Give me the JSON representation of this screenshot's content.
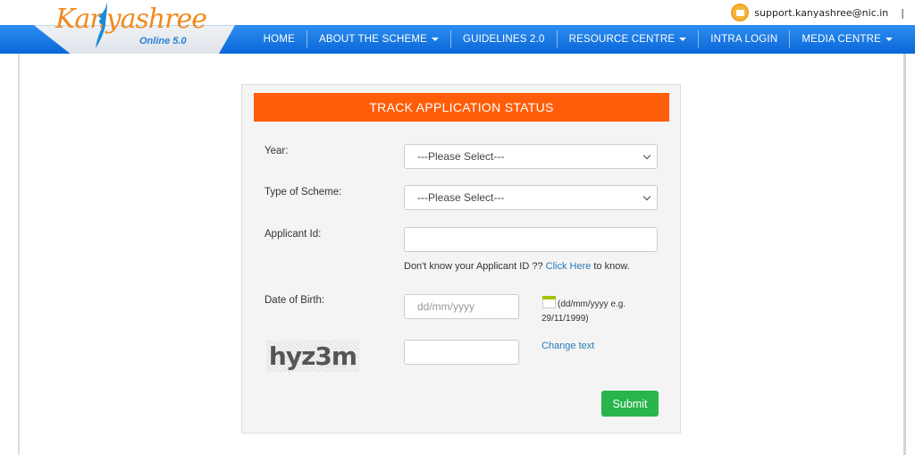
{
  "header": {
    "logo_text": "Kanyashree",
    "logo_subtitle": "Online 5.0",
    "support_email": "support.kanyashree@nic.in",
    "separator": "|"
  },
  "nav": {
    "items": [
      {
        "label": "HOME",
        "dropdown": false
      },
      {
        "label": "ABOUT THE SCHEME",
        "dropdown": true
      },
      {
        "label": "GUIDELINES 2.0",
        "dropdown": false
      },
      {
        "label": "RESOURCE CENTRE",
        "dropdown": true
      },
      {
        "label": "INTRA LOGIN",
        "dropdown": false
      },
      {
        "label": "MEDIA CENTRE",
        "dropdown": true
      }
    ]
  },
  "form": {
    "title": "TRACK APPLICATION STATUS",
    "year_label": "Year:",
    "year_value": "---Please Select---",
    "scheme_label": "Type of Scheme:",
    "scheme_value": "---Please Select---",
    "applicant_label": "Applicant Id:",
    "applicant_value": "",
    "hint_prefix": "Don't know your Applicant ID ?? ",
    "hint_link": "Click Here",
    "hint_suffix": " to know.",
    "dob_label": "Date of Birth:",
    "dob_placeholder": "dd/mm/yyyy",
    "dob_hint": "(dd/mm/yyyy e.g. 29/11/1999)",
    "captcha_text": "hyz3m",
    "captcha_value": "",
    "change_text": "Change text",
    "submit_label": "Submit"
  },
  "colors": {
    "nav_blue": "#1a7ae6",
    "header_orange": "#ff5d0a",
    "submit_green": "#28b54a",
    "link_blue": "#2a7ab8"
  }
}
